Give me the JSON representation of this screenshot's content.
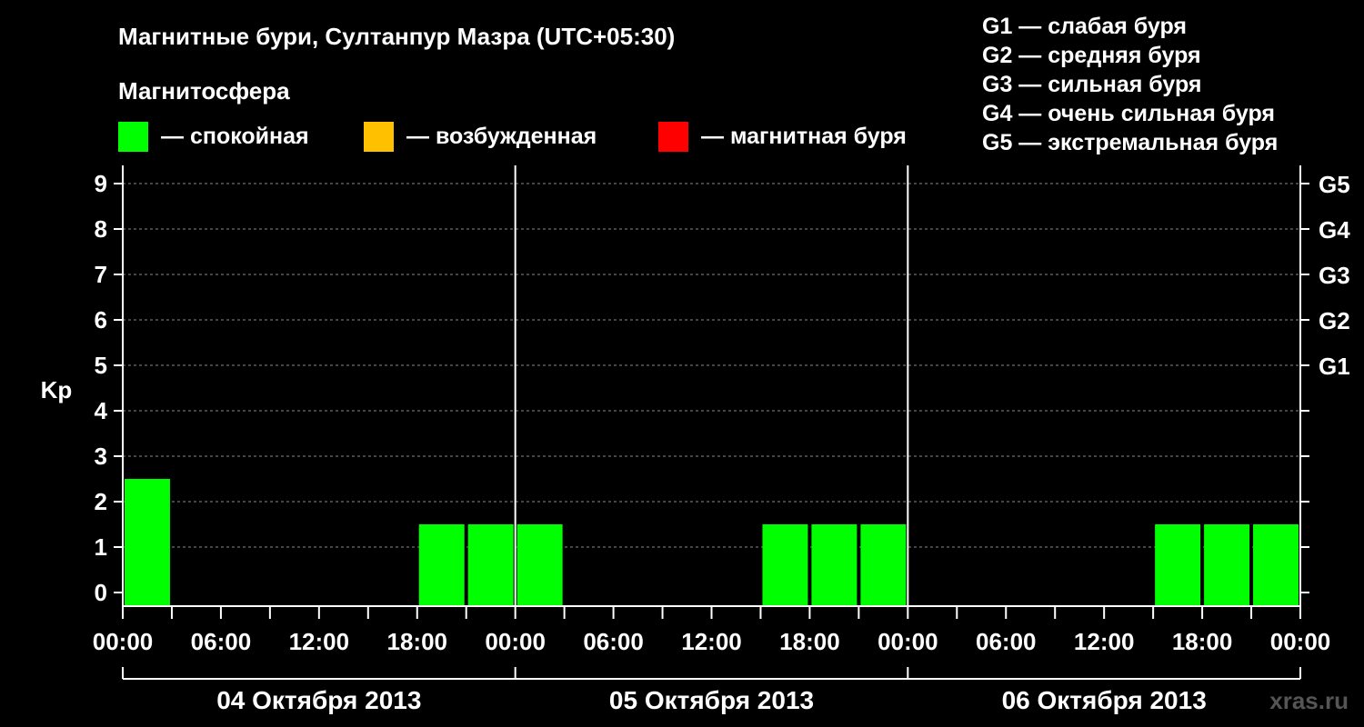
{
  "header": {
    "title": "Магнитные бури, Султанпур Мазра (UTC+05:30)",
    "magnetosphere_label": "Магнитосфера"
  },
  "legend": {
    "items": [
      {
        "label": "— спокойная",
        "color": "#00ff00"
      },
      {
        "label": "— возбужденная",
        "color": "#ffc000"
      },
      {
        "label": "— магнитная буря",
        "color": "#ff0000"
      }
    ]
  },
  "g_scale": [
    "G1 — слабая буря",
    "G2 — средняя буря",
    "G3 — сильная буря",
    "G4 — очень сильная буря",
    "G5 — экстремальная буря"
  ],
  "watermark": "xras.ru",
  "chart_data": {
    "type": "bar",
    "ylabel": "Kp",
    "ylim": [
      0,
      9
    ],
    "y_ticks": [
      "0",
      "1",
      "2",
      "3",
      "4",
      "5",
      "6",
      "7",
      "8",
      "9"
    ],
    "right_axis_labels": [
      {
        "kp": 5,
        "label": "G1"
      },
      {
        "kp": 6,
        "label": "G2"
      },
      {
        "kp": 7,
        "label": "G3"
      },
      {
        "kp": 8,
        "label": "G4"
      },
      {
        "kp": 9,
        "label": "G5"
      }
    ],
    "x_tick_labels": [
      "00:00",
      "06:00",
      "12:00",
      "18:00",
      "00:00",
      "06:00",
      "12:00",
      "18:00",
      "00:00",
      "06:00",
      "12:00",
      "18:00",
      "00:00"
    ],
    "days": [
      "04 Октября 2013",
      "05 Октября 2013",
      "06 Октября 2013"
    ],
    "interval_hours": 3,
    "grid": true,
    "bars": [
      {
        "day": 0,
        "start_hour": 0,
        "kp": 2,
        "level": "quiet"
      },
      {
        "day": 0,
        "start_hour": 3,
        "kp": 0,
        "level": "quiet"
      },
      {
        "day": 0,
        "start_hour": 6,
        "kp": 0,
        "level": "quiet"
      },
      {
        "day": 0,
        "start_hour": 9,
        "kp": 0,
        "level": "quiet"
      },
      {
        "day": 0,
        "start_hour": 12,
        "kp": 0,
        "level": "quiet"
      },
      {
        "day": 0,
        "start_hour": 15,
        "kp": 0,
        "level": "quiet"
      },
      {
        "day": 0,
        "start_hour": 18,
        "kp": 1,
        "level": "quiet"
      },
      {
        "day": 0,
        "start_hour": 21,
        "kp": 1,
        "level": "quiet"
      },
      {
        "day": 1,
        "start_hour": 0,
        "kp": 1,
        "level": "quiet"
      },
      {
        "day": 1,
        "start_hour": 3,
        "kp": 0,
        "level": "quiet"
      },
      {
        "day": 1,
        "start_hour": 6,
        "kp": 0,
        "level": "quiet"
      },
      {
        "day": 1,
        "start_hour": 9,
        "kp": 0,
        "level": "quiet"
      },
      {
        "day": 1,
        "start_hour": 12,
        "kp": 0,
        "level": "quiet"
      },
      {
        "day": 1,
        "start_hour": 15,
        "kp": 1,
        "level": "quiet"
      },
      {
        "day": 1,
        "start_hour": 18,
        "kp": 1,
        "level": "quiet"
      },
      {
        "day": 1,
        "start_hour": 21,
        "kp": 1,
        "level": "quiet"
      },
      {
        "day": 2,
        "start_hour": 0,
        "kp": 0,
        "level": "quiet"
      },
      {
        "day": 2,
        "start_hour": 3,
        "kp": 0,
        "level": "quiet"
      },
      {
        "day": 2,
        "start_hour": 6,
        "kp": 0,
        "level": "quiet"
      },
      {
        "day": 2,
        "start_hour": 9,
        "kp": 0,
        "level": "quiet"
      },
      {
        "day": 2,
        "start_hour": 12,
        "kp": 0,
        "level": "quiet"
      },
      {
        "day": 2,
        "start_hour": 15,
        "kp": 1,
        "level": "quiet"
      },
      {
        "day": 2,
        "start_hour": 18,
        "kp": 1,
        "level": "quiet"
      },
      {
        "day": 2,
        "start_hour": 21,
        "kp": 1,
        "level": "quiet"
      }
    ],
    "level_colors": {
      "quiet": "#00ff00",
      "active": "#ffc000",
      "storm": "#ff0000"
    }
  }
}
